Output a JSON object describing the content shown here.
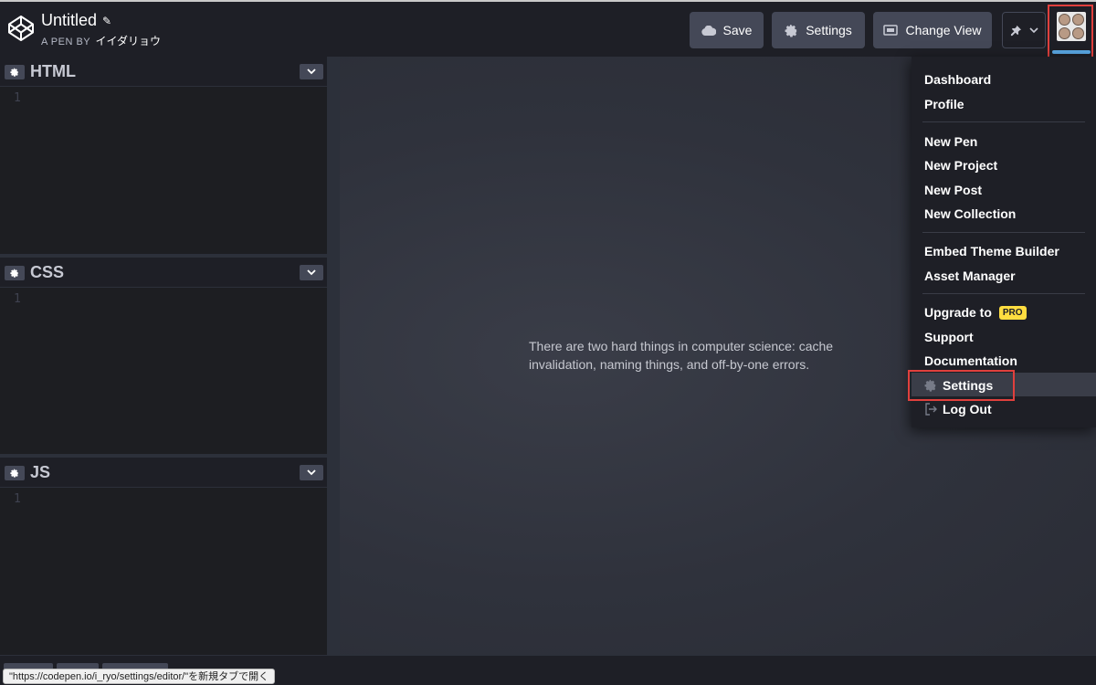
{
  "header": {
    "pen_title": "Untitled",
    "pen_by_label": "A PEN BY",
    "author": "イイダリョウ",
    "save_label": "Save",
    "settings_label": "Settings",
    "change_view_label": "Change View"
  },
  "editors": [
    {
      "name": "HTML",
      "line": "1"
    },
    {
      "name": "CSS",
      "line": "1"
    },
    {
      "name": "JS",
      "line": "1"
    }
  ],
  "preview": {
    "text": "There are two hard things in computer science: cache invalidation, naming things, and off-by-one errors."
  },
  "menu": {
    "dashboard": "Dashboard",
    "profile": "Profile",
    "new_pen": "New Pen",
    "new_project": "New Project",
    "new_post": "New Post",
    "new_collection": "New Collection",
    "embed_theme_builder": "Embed Theme Builder",
    "asset_manager": "Asset Manager",
    "upgrade_to": "Upgrade to",
    "pro_badge": "PRO",
    "support": "Support",
    "documentation": "Documentation",
    "settings": "Settings",
    "log_out": "Log Out"
  },
  "status_bar": {
    "url": "\"https://codepen.io/i_ryo/settings/editor/\"を新規タブで開く"
  },
  "colors": {
    "accent_red": "#e0403d",
    "pro_yellow": "#ffdd40",
    "button_bg": "#444857"
  }
}
